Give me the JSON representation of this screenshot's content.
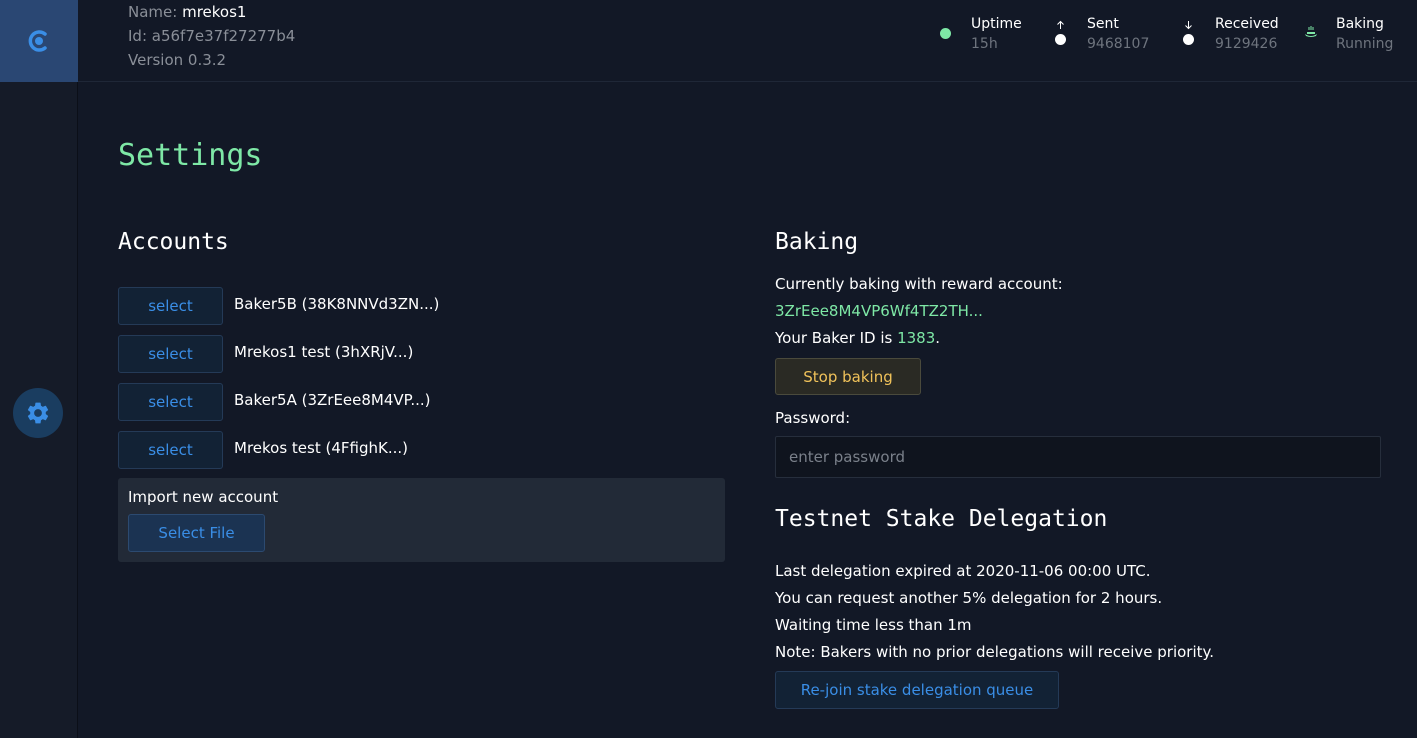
{
  "header": {
    "name_label": "Name:",
    "name_value": "mrekos1",
    "id_label": "Id:",
    "id_value": "a56f7e37f27277b4",
    "version_text": "Version 0.3.2",
    "stats": [
      {
        "label": "Uptime",
        "value": "15h",
        "icon": "status-dot-icon",
        "color": "#7ee8a6"
      },
      {
        "label": "Sent",
        "value": "9468107",
        "icon": "arrow-up-icon"
      },
      {
        "label": "Received",
        "value": "9129426",
        "icon": "arrow-down-icon"
      },
      {
        "label": "Baking",
        "value": "Running",
        "icon": "baking-icon",
        "color": "#7ee8a6"
      }
    ]
  },
  "sidebar": {
    "logo_icon": "concordium-logo-icon",
    "settings_icon": "gear-icon"
  },
  "page": {
    "title": "Settings"
  },
  "accounts": {
    "title": "Accounts",
    "select_label": "select",
    "items": [
      {
        "name": "Baker5B (38K8NNVd3ZN...)"
      },
      {
        "name": "Mrekos1 test (3hXRjV...)"
      },
      {
        "name": "Baker5A (3ZrEee8M4VP...)"
      },
      {
        "name": "Mrekos test (4FfighK...)"
      }
    ],
    "import_label": "Import new account",
    "select_file_label": "Select File"
  },
  "baking": {
    "title": "Baking",
    "reward_text": "Currently baking with reward account:",
    "reward_account": "3ZrEee8M4VP6Wf4TZ2TH...",
    "baker_id_prefix": "Your Baker ID is ",
    "baker_id": "1383",
    "baker_id_suffix": ".",
    "stop_label": "Stop baking",
    "password_label": "Password:",
    "password_placeholder": "enter password"
  },
  "delegation": {
    "title": "Testnet Stake Delegation",
    "lines": [
      "Last delegation expired at 2020-11-06 00:00 UTC.",
      "You can request another 5% delegation for 2 hours.",
      "Waiting time less than 1m",
      "Note: Bakers with no prior delegations will receive priority."
    ],
    "rejoin_label": "Re-join stake delegation queue"
  },
  "colors": {
    "accent_green": "#7ee8a6",
    "accent_blue": "#3a8ee6",
    "warning_yellow": "#f0c25a",
    "background": "#121826"
  }
}
